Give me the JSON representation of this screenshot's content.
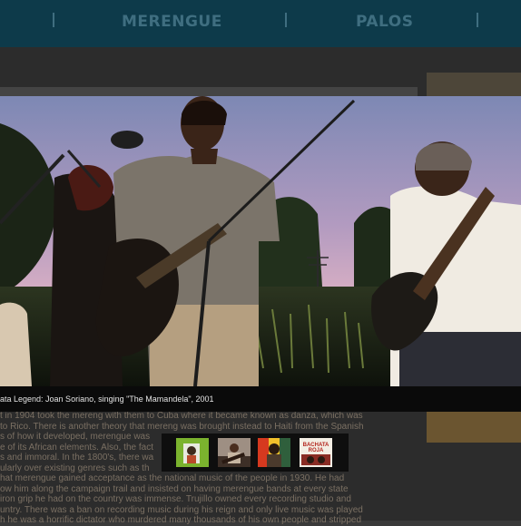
{
  "nav": {
    "items": [
      {
        "label": "MERENGUE"
      },
      {
        "label": "PALOS"
      }
    ]
  },
  "photo": {
    "caption": "ata Legend: Joan Soriano, singing \"The Mamandela\",  2001"
  },
  "article": {
    "lines": [
      "t in 1904 took the mereng with them to Cuba where it became known as danza, which was",
      "to Rico. There is another theory that mereng was brought instead to Haiti from the Spanish",
      "s of how it developed, merengue was",
      "e of its African elements.  Also, the fact",
      "s and immoral.  In the 1800's, there wa",
      "ularly over existing genres such as th",
      "hat merengue gained acceptance as the national music of the people in 1930.  He had",
      "ow him along the campaign trail and insisted on having merengue bands at every state",
      "iron grip he had on the country was immense.  Trujillo owned every recording studio and",
      "untry.  There was a ban on recording music during his reign and only live music was played",
      "h he was a horrific dictator who murdered many thousands of his own people and stripped"
    ]
  },
  "thumbnails": [
    {
      "label": ""
    },
    {
      "label": ""
    },
    {
      "label": ""
    },
    {
      "label": "BACHATA ROJA"
    }
  ],
  "colors": {
    "nav_bg": "#0d3a4a",
    "nav_text": "#3f6e80",
    "overlay": "#2c2c2c",
    "caption_bg": "#0a0a0a"
  }
}
